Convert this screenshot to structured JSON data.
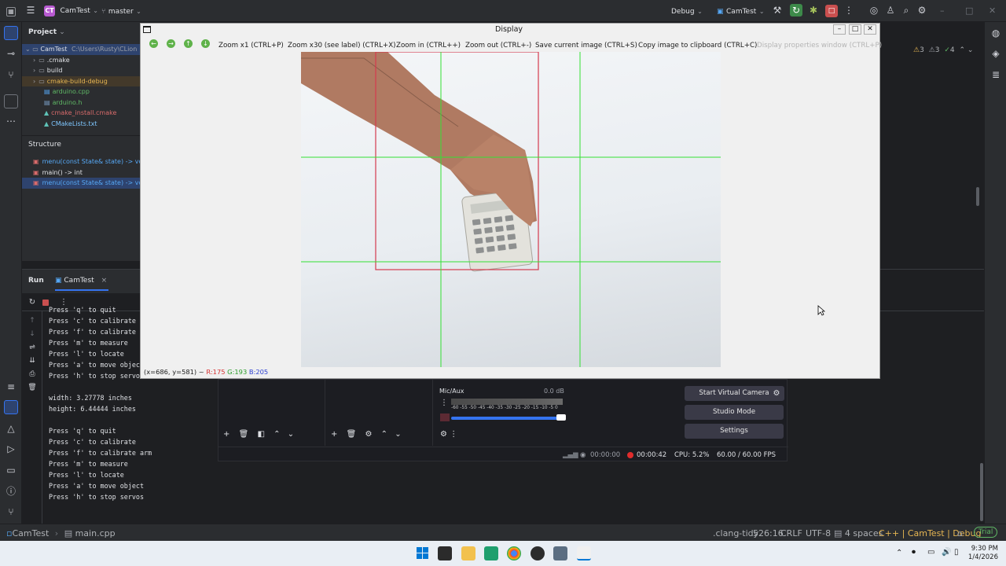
{
  "titlebar": {
    "project_badge": "CT",
    "project_name": "CamTest",
    "branch": "master",
    "config": "Debug",
    "target": "CamTest"
  },
  "project_panel": {
    "title": "Project",
    "root_name": "CamTest",
    "root_path": "C:\\Users\\Rusty\\CLion",
    "items": [
      {
        "label": ".cmake",
        "kind": "folder"
      },
      {
        "label": "build",
        "kind": "folder"
      },
      {
        "label": "cmake-build-debug",
        "kind": "folder"
      },
      {
        "label": "arduino.cpp",
        "kind": "cpp"
      },
      {
        "label": "arduino.h",
        "kind": "h"
      },
      {
        "label": "cmake_install.cmake",
        "kind": "cmake"
      },
      {
        "label": "CMakeLists.txt",
        "kind": "cmake"
      }
    ]
  },
  "structure_panel": {
    "title": "Structure",
    "items": [
      "menu(const State& state) -> void",
      "main() -> int",
      "menu(const State& state) -> void"
    ]
  },
  "editor": {
    "inspections": {
      "warnings": "3",
      "weak": "3",
      "ok": "4"
    }
  },
  "run_panel": {
    "tab_label": "Run",
    "config_tab": "CamTest",
    "lines": [
      "Press 'q' to quit",
      "Press 'c' to calibrate",
      "Press 'f' to calibrate arm",
      "Press 'm' to measure",
      "Press 'l' to locate",
      "Press 'a' to move object",
      "Press 'h' to stop servos",
      "",
      "width: 3.27778 inches",
      "height: 6.44444 inches",
      "",
      "Press 'q' to quit",
      "Press 'c' to calibrate",
      "Press 'f' to calibrate arm",
      "Press 'm' to measure",
      "Press 'l' to locate",
      "Press 'a' to move object",
      "Press 'h' to stop servos"
    ]
  },
  "display_window": {
    "title": "Display",
    "toolbar": {
      "zoom_x1": "Zoom x1 (CTRL+P)",
      "zoom_x30": "Zoom x30 (see label) (CTRL+X)",
      "zoom_in": "Zoom in (CTRL++)",
      "zoom_out": "Zoom out (CTRL+-)",
      "save": "Save current image (CTRL+S)",
      "copy": "Copy image to clipboard (CTRL+C)",
      "props": "Display properties window (CTRL+P)"
    },
    "status": {
      "coords": "(x=686, y=581) ~",
      "r": "R:175",
      "g": "G:193",
      "b": "B:205"
    }
  },
  "obs": {
    "mixer_label": "Mic/Aux",
    "mixer_db": "0.0 dB",
    "meter_scale": "-60 -55 -50 -45 -40 -35 -30 -25 -20 -15 -10 -5 0",
    "buttons": {
      "virtual_cam": "Start Virtual Camera",
      "studio": "Studio Mode",
      "settings": "Settings"
    },
    "stats": {
      "stream_time": "00:00:00",
      "rec_time": "00:00:42",
      "cpu": "CPU: 5.2%",
      "fps": "60.00 / 60.00 FPS"
    }
  },
  "statusbar": {
    "crumb_project": "CamTest",
    "crumb_file": "main.cpp",
    "linter": ".clang-tidy",
    "position": "526:16",
    "line_ending": "CRLF",
    "encoding": "UTF-8",
    "indent": "4 spaces",
    "context": "C++ | CamTest | Debug",
    "license": "Trial"
  },
  "taskbar": {
    "time": "9:30 PM",
    "date": "1/4/2026"
  },
  "colors": {
    "accent": "#3574f0",
    "grid_green": "#33e033",
    "roi_red": "#d43a4e"
  }
}
